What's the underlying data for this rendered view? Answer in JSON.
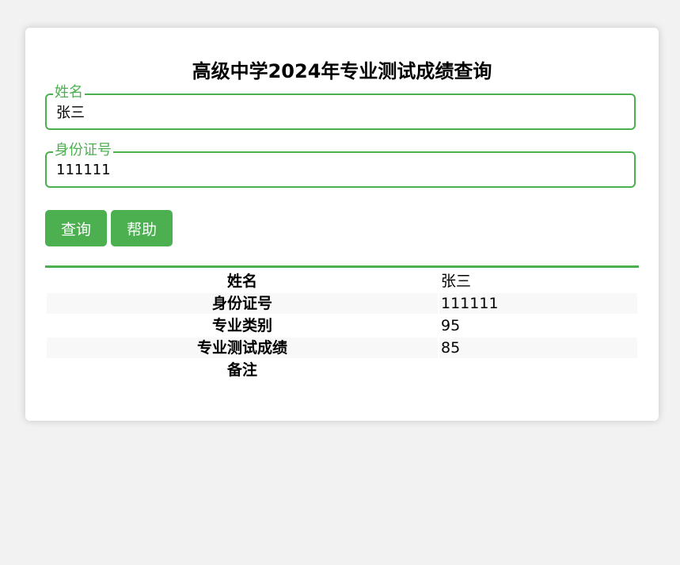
{
  "title": "高级中学2024年专业测试成绩查询",
  "form": {
    "name_field": {
      "label": "姓名",
      "value": "张三"
    },
    "id_field": {
      "label": "身份证号",
      "value": "111111"
    }
  },
  "buttons": {
    "query_label": "查询",
    "help_label": "帮助"
  },
  "colors": {
    "accent": "#4CAF50",
    "background": "#f2f2f2",
    "card": "#ffffff",
    "row_alt": "#f8f8f8"
  },
  "result": {
    "rows": [
      {
        "label": "姓名",
        "value": "张三"
      },
      {
        "label": "身份证号",
        "value": "111111"
      },
      {
        "label": "专业类别",
        "value": "95"
      },
      {
        "label": "专业测试成绩",
        "value": "85"
      },
      {
        "label": "备注",
        "value": ""
      }
    ]
  }
}
